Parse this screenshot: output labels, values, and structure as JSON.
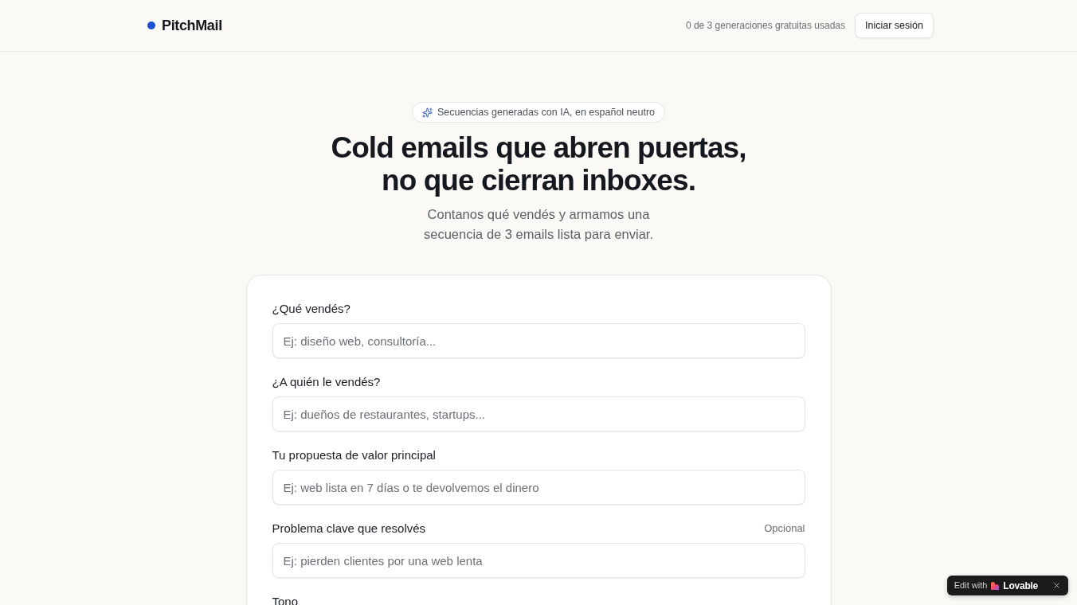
{
  "header": {
    "brand": "PitchMail",
    "usage": "0 de 3 generaciones gratuitas usadas",
    "login_button": "Iniciar sesión"
  },
  "hero": {
    "badge": "Secuencias generadas con IA, en español neutro",
    "title_lines": [
      "Cold emails que abren puertas,",
      "no que cierran inboxes."
    ],
    "subtitle_lines": [
      "Contanos qué vendés y armamos una",
      "secuencia de 3 emails lista para enviar."
    ]
  },
  "form": {
    "fields": [
      {
        "label": "¿Qué vendés?",
        "placeholder": "Ej: diseño web, consultoría..."
      },
      {
        "label": "¿A quién le vendés?",
        "placeholder": "Ej: dueños de restaurantes, startups..."
      },
      {
        "label": "Tu propuesta de valor principal",
        "placeholder": "Ej: web lista en 7 días o te devolvemos el dinero"
      },
      {
        "label": "Problema clave que resolvés",
        "note": "Opcional",
        "placeholder": "Ej: pierden clientes por una web lenta"
      },
      {
        "label": "Tono"
      }
    ]
  },
  "edit_badge": {
    "prefix": "Edit with",
    "brand": "Lovable"
  }
}
